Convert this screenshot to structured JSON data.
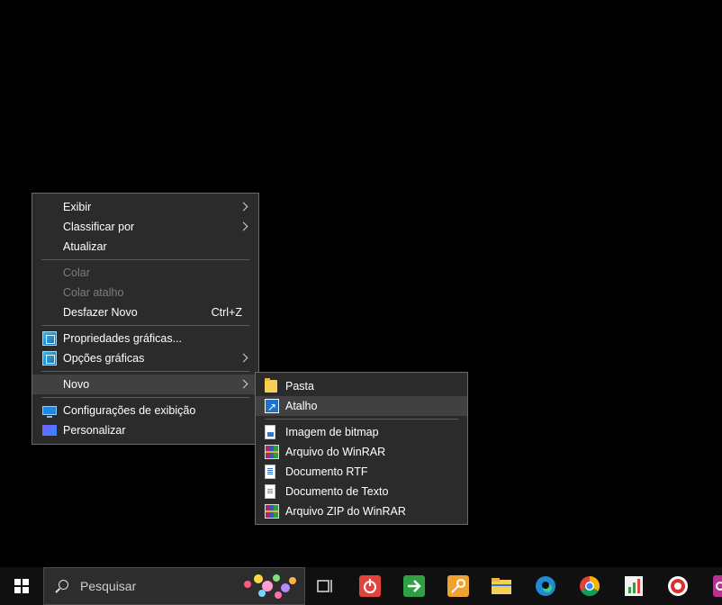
{
  "context_menu": {
    "items": [
      {
        "label": "Exibir",
        "submenu": true
      },
      {
        "label": "Classificar por",
        "submenu": true
      },
      {
        "label": "Atualizar"
      },
      {
        "label": "Colar",
        "disabled": true
      },
      {
        "label": "Colar atalho",
        "disabled": true
      },
      {
        "label": "Desfazer Novo",
        "shortcut": "Ctrl+Z"
      },
      {
        "label": "Propriedades gráficas...",
        "icon": "graphics-properties-icon"
      },
      {
        "label": "Opções gráficas",
        "icon": "graphics-options-icon",
        "submenu": true
      },
      {
        "label": "Novo",
        "submenu": true,
        "highlighted": true
      },
      {
        "label": "Configurações de exibição",
        "icon": "display-settings-icon"
      },
      {
        "label": "Personalizar",
        "icon": "personalize-icon"
      }
    ]
  },
  "new_submenu": {
    "items": [
      {
        "label": "Pasta",
        "icon": "folder-icon"
      },
      {
        "label": "Atalho",
        "icon": "shortcut-icon",
        "highlighted": true
      },
      {
        "label": "Imagem de bitmap",
        "icon": "bitmap-image-icon"
      },
      {
        "label": "Arquivo do WinRAR",
        "icon": "winrar-archive-icon"
      },
      {
        "label": "Documento RTF",
        "icon": "rtf-document-icon"
      },
      {
        "label": "Documento de Texto",
        "icon": "text-document-icon"
      },
      {
        "label": "Arquivo ZIP do WinRAR",
        "icon": "winrar-zip-icon"
      }
    ]
  },
  "taskbar": {
    "search_placeholder": "Pesquisar",
    "apps": [
      "task-view-icon",
      "red-power-app-icon",
      "green-arrow-app-icon",
      "key-app-icon",
      "file-explorer-icon",
      "edge-browser-icon",
      "chrome-browser-icon",
      "chart-app-icon",
      "red-record-app-icon",
      "purple-app-icon"
    ]
  },
  "colors": {
    "desktop": "#000000",
    "menu_background": "#2b2b2b",
    "menu_highlight": "#414141",
    "disabled_text": "#7c7c7c"
  }
}
